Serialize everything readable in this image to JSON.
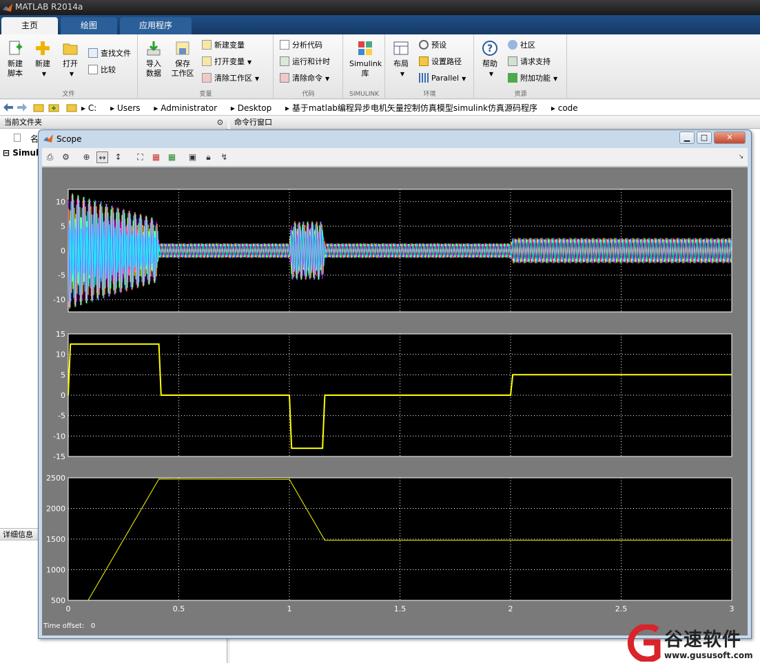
{
  "app": {
    "title": "MATLAB R2014a"
  },
  "tabs": [
    {
      "label": "主页"
    },
    {
      "label": "绘图"
    },
    {
      "label": "应用程序"
    }
  ],
  "ribbon": {
    "file": {
      "label": "文件",
      "new_script": "新建\n脚本",
      "new": "新建",
      "open": "打开",
      "find_files": "查找文件",
      "compare": "比较"
    },
    "variable": {
      "label": "变量",
      "import": "导入\n数据",
      "save_ws": "保存\n工作区",
      "new_var": "新建变量",
      "open_var": "打开变量",
      "clear_ws": "清除工作区"
    },
    "code": {
      "label": "代码",
      "analyze": "分析代码",
      "run_time": "运行和计时",
      "clear_cmd": "清除命令"
    },
    "simulink": {
      "label": "SIMULINK",
      "lib": "Simulink\n库"
    },
    "env": {
      "label": "环境",
      "layout": "布局",
      "prefs": "预设",
      "set_path": "设置路径",
      "parallel": "Parallel"
    },
    "resources": {
      "label": "资源",
      "help": "帮助",
      "community": "社区",
      "support": "请求支持",
      "addons": "附加功能"
    }
  },
  "path": [
    "C:",
    "Users",
    "Administrator",
    "Desktop",
    "基于matlab编程异步电机矢量控制仿真模型simulink仿真源码程序",
    "code"
  ],
  "left_panel": {
    "header": "当前文件夹",
    "col": "名",
    "item": "Simul",
    "details": "详细信息"
  },
  "cmd_header": "命令行窗口",
  "scope": {
    "title": "Scope",
    "time_offset_label": "Time offset:",
    "time_offset": "0"
  },
  "chart_data": [
    {
      "type": "line",
      "x": [
        0,
        0.4,
        0.41,
        1.0,
        1.01,
        1.15,
        1.16,
        2.0,
        2.01,
        3.0
      ],
      "series": [
        {
          "values": [
            12,
            6.5,
            1.5,
            1.5,
            6,
            6,
            1.5,
            1.5,
            2.6,
            2.6
          ]
        }
      ],
      "yticks": [
        "10",
        "5",
        "0",
        "-5",
        "-10"
      ],
      "ylim": [
        -12.5,
        12.5
      ],
      "xlim": [
        0,
        3
      ],
      "grid": true
    },
    {
      "type": "line",
      "x": [
        0,
        0.01,
        0.41,
        0.42,
        1.0,
        1.01,
        1.15,
        1.16,
        2.0,
        2.01,
        3.0
      ],
      "series": [
        {
          "values": [
            0,
            12.5,
            12.5,
            0,
            0,
            -13,
            -13,
            0,
            0,
            5,
            5
          ]
        }
      ],
      "yticks": [
        "15",
        "10",
        "5",
        "0",
        "-5",
        "-10",
        "-15"
      ],
      "ylim": [
        -15,
        15
      ],
      "xlim": [
        0,
        3
      ],
      "grid": true
    },
    {
      "type": "line",
      "x": [
        0.09,
        0.41,
        1.0,
        1.16,
        3.0
      ],
      "series": [
        {
          "values": [
            500,
            2480,
            2475,
            1480,
            1480
          ]
        }
      ],
      "yticks": [
        "2500",
        "2000",
        "1500",
        "1000",
        "500"
      ],
      "ylim": [
        500,
        2500
      ],
      "xlim": [
        0,
        3
      ],
      "xticks": [
        "0",
        "0.5",
        "1",
        "1.5",
        "2",
        "2.5",
        "3"
      ],
      "grid": true
    }
  ],
  "watermark": {
    "name": "谷速软件",
    "url": "www.gususoft.com"
  }
}
